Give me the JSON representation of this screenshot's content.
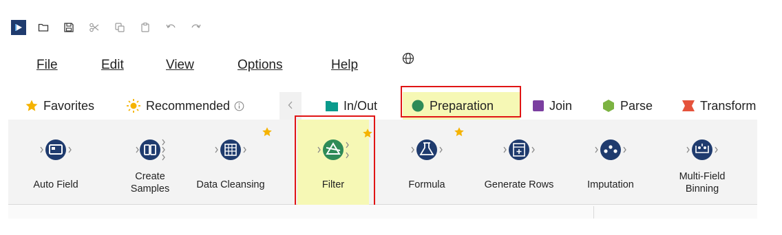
{
  "quick_access": {
    "icons": [
      "app-logo-icon",
      "new-folder-icon",
      "save-icon",
      "cut-icon",
      "copy-icon",
      "paste-icon",
      "undo-icon",
      "redo-icon"
    ]
  },
  "menu": {
    "items": [
      {
        "label": "File"
      },
      {
        "label": "Edit"
      },
      {
        "label": "View"
      },
      {
        "label": "Options"
      },
      {
        "label": "Help"
      }
    ],
    "globe_icon": "globe-icon"
  },
  "tabs": [
    {
      "label": "Favorites",
      "icon": "star-icon",
      "color": "#f5b301"
    },
    {
      "label": "Recommended",
      "icon": "sun-icon",
      "color": "#f5b301"
    },
    {
      "label": "In/Out",
      "icon": "folder-icon",
      "color": "#0a9a8c"
    },
    {
      "label": "Preparation",
      "icon": "circle-icon",
      "color": "#2e8b57",
      "selected": true
    },
    {
      "label": "Join",
      "icon": "square-icon",
      "color": "#7b3fa0"
    },
    {
      "label": "Parse",
      "icon": "hexagon-icon",
      "color": "#7cb342"
    },
    {
      "label": "Transform",
      "icon": "transform-icon",
      "color": "#e5533c"
    }
  ],
  "tools": [
    {
      "label": "Auto Field",
      "favorite": false
    },
    {
      "label": "Create\nSamples",
      "favorite": false
    },
    {
      "label": "Data Cleansing",
      "favorite": true
    },
    {
      "label": "Filter",
      "favorite": true,
      "highlighted": true
    },
    {
      "label": "Formula",
      "favorite": true
    },
    {
      "label": "Generate Rows",
      "favorite": false
    },
    {
      "label": "Imputation",
      "favorite": false
    },
    {
      "label": "Multi-Field\nBinning",
      "favorite": false
    }
  ],
  "colors": {
    "tool_blue": "#1f3b6e",
    "highlight": "#f6f8b5",
    "outline_red": "#e01414",
    "star": "#f5b301"
  }
}
